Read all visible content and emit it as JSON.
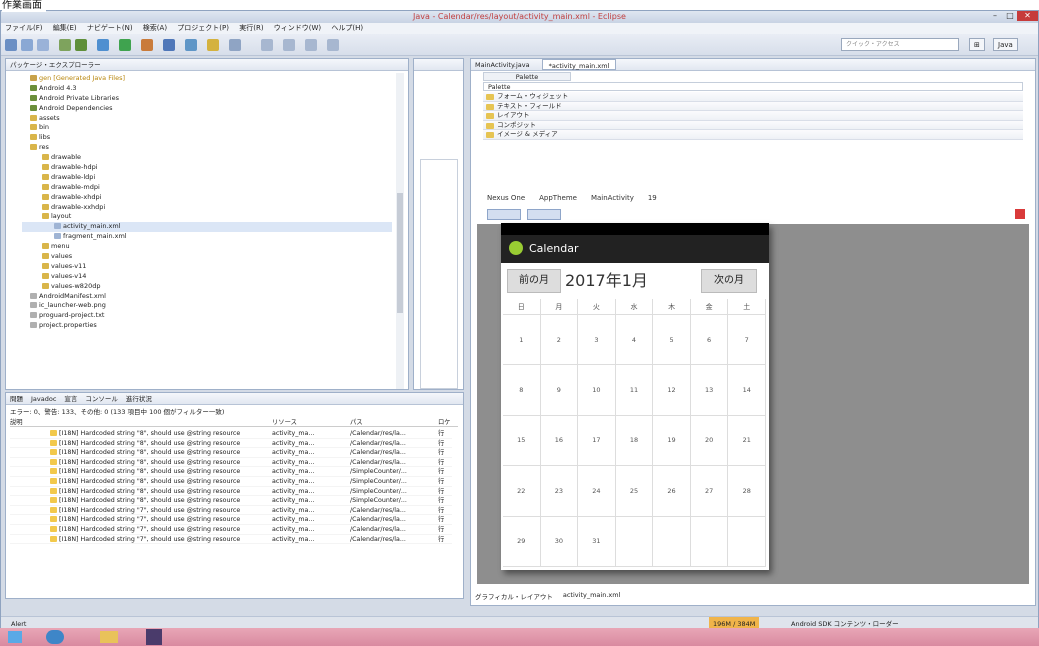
{
  "top_title": "作業画面",
  "window": {
    "title": "Java - Calendar/res/layout/activity_main.xml - Eclipse"
  },
  "menu": [
    "ファイル(F)",
    "編集(E)",
    "ナビゲート(N)",
    "検索(A)",
    "プロジェクト(P)",
    "実行(R)",
    "ウィンドウ(W)",
    "ヘルプ(H)"
  ],
  "toolbar": {
    "quick_access": "クイック・アクセス",
    "perspective": "Java"
  },
  "package_explorer": {
    "title": "パッケージ・エクスプローラー",
    "items": [
      "gen [Generated Java Files]",
      "Android 4.3",
      "Android Private Libraries",
      "Android Dependencies",
      "assets",
      "bin",
      "libs",
      "res",
      "drawable",
      "drawable-hdpi",
      "drawable-ldpi",
      "drawable-mdpi",
      "drawable-xhdpi",
      "drawable-xxhdpi",
      "layout",
      "activity_main.xml",
      "fragment_main.xml",
      "menu",
      "values",
      "values-v11",
      "values-v14",
      "values-w820dp",
      "AndroidManifest.xml",
      "ic_launcher-web.png",
      "proguard-project.txt",
      "project.properties"
    ]
  },
  "problems": {
    "tabs": [
      "問題",
      "Javadoc",
      "宣言",
      "コンソール",
      "進行状況"
    ],
    "summary": "エラー: 0、警告: 133、その他: 0 (133 項目中 100 個がフィルター一致)",
    "columns": [
      "説明",
      "リソース",
      "パス",
      "ロケ"
    ],
    "rows": [
      [
        "[I18N] Hardcoded string \"8\", should use @string resource",
        "activity_ma...",
        "/Calendar/res/la...",
        "行"
      ],
      [
        "[I18N] Hardcoded string \"8\", should use @string resource",
        "activity_ma...",
        "/Calendar/res/la...",
        "行"
      ],
      [
        "[I18N] Hardcoded string \"8\", should use @string resource",
        "activity_ma...",
        "/Calendar/res/la...",
        "行"
      ],
      [
        "[I18N] Hardcoded string \"8\", should use @string resource",
        "activity_ma...",
        "/Calendar/res/la...",
        "行"
      ],
      [
        "[I18N] Hardcoded string \"8\", should use @string resource",
        "activity_ma...",
        "/SimpleCounter/...",
        "行"
      ],
      [
        "[I18N] Hardcoded string \"8\", should use @string resource",
        "activity_ma...",
        "/SimpleCounter/...",
        "行"
      ],
      [
        "[I18N] Hardcoded string \"8\", should use @string resource",
        "activity_ma...",
        "/SimpleCounter/...",
        "行"
      ],
      [
        "[I18N] Hardcoded string \"8\", should use @string resource",
        "activity_ma...",
        "/SimpleCounter/...",
        "行"
      ],
      [
        "[I18N] Hardcoded string \"7\", should use @string resource",
        "activity_ma...",
        "/Calendar/res/la...",
        "行"
      ],
      [
        "[I18N] Hardcoded string \"7\", should use @string resource",
        "activity_ma...",
        "/Calendar/res/la...",
        "行"
      ],
      [
        "[I18N] Hardcoded string \"7\", should use @string resource",
        "activity_ma...",
        "/Calendar/res/la...",
        "行"
      ],
      [
        "[I18N] Hardcoded string \"7\", should use @string resource",
        "activity_ma...",
        "/Calendar/res/la...",
        "行"
      ]
    ]
  },
  "editor": {
    "tabs": [
      "MainActivity.java",
      "*activity_main.xml"
    ],
    "palette": {
      "title": "Palette",
      "filter": "Palette",
      "categories": [
        "フォーム・ウィジェット",
        "テキスト・フィールド",
        "レイアウト",
        "コンポジット",
        "イメージ & メディア"
      ]
    },
    "config": {
      "device": "Nexus One",
      "theme": "AppTheme",
      "activity": "MainActivity",
      "api": "19"
    },
    "bottom_tabs": [
      "グラフィカル・レイアウト",
      "activity_main.xml"
    ]
  },
  "app": {
    "title": "Calendar",
    "prev": "前の月",
    "month": "2017年1月",
    "next": "次の月",
    "weekdays": [
      "日",
      "月",
      "火",
      "水",
      "木",
      "金",
      "土"
    ],
    "days": [
      "1",
      "2",
      "3",
      "4",
      "5",
      "6",
      "7",
      "8",
      "9",
      "10",
      "11",
      "12",
      "13",
      "14",
      "15",
      "16",
      "17",
      "18",
      "19",
      "20",
      "21",
      "22",
      "23",
      "24",
      "25",
      "26",
      "27",
      "28",
      "29",
      "30",
      "31",
      "",
      "",
      "",
      ""
    ]
  },
  "status": {
    "left": "Alert",
    "memory": "196M / 384M",
    "sdk": "Android SDK コンテンツ・ローダー"
  },
  "colors": {
    "accent": "#3a5f9b",
    "action_bar": "#222222"
  }
}
